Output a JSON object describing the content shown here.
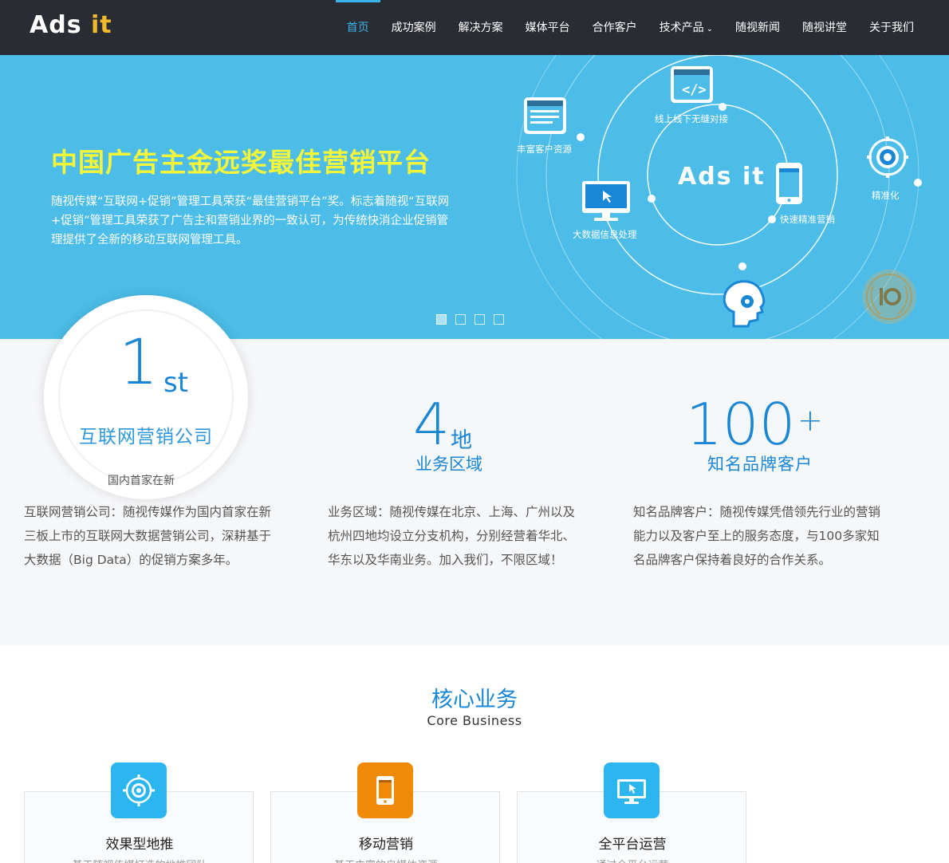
{
  "brand": {
    "logo_main": "Ads ",
    "logo_accent": "it"
  },
  "nav": {
    "items": [
      {
        "label": "首页",
        "active": true
      },
      {
        "label": "成功案例"
      },
      {
        "label": "解决方案"
      },
      {
        "label": "媒体平台"
      },
      {
        "label": "合作客户"
      },
      {
        "label": "技术产品",
        "dropdown": true
      },
      {
        "label": "随视新闻"
      },
      {
        "label": "随视讲堂"
      },
      {
        "label": "关于我们"
      }
    ]
  },
  "hero": {
    "title": "中国广告主金远奖最佳营销平台",
    "description": "随视传媒“互联网+促销”管理工具荣获“最佳营销平台”奖。标志着随视“互联网+促销”管理工具荣获了广告主和营销业界的一致认可，为传统快消企业促销管理提供了全新的移动互联网管理工具。",
    "art": {
      "center_logo": "Ads it",
      "labels": {
        "rich": "丰富客户资源",
        "online": "线上线下无缝对接",
        "precise": "精准化",
        "bigdata": "大数据信息处理",
        "fast": "快速精准营销"
      }
    },
    "slides": 4,
    "active_slide": 1
  },
  "stats": {
    "circle": {
      "number": "1",
      "suffix": "st",
      "label": "互联网营销公司",
      "sub": "国内首家在新"
    },
    "regions": {
      "number": "4",
      "unit": "地",
      "label": "业务区域"
    },
    "brands": {
      "number": "100",
      "plus": "+",
      "label": "知名品牌客户"
    },
    "texts": [
      "互联网营销公司：随视传媒作为国内首家在新三板上市的互联网大数据营销公司，深耕基于大数据（Big Data）的促销方案多年。",
      "业务区域：随视传媒在北京、上海、广州以及杭州四地均设立分支机构，分别经营着华北、华东以及华南业务。加入我们，不限区域！",
      "知名品牌客户：随视传媒凭借领先行业的营销能力以及客户至上的服务态度，与100多家知名品牌客户保持着良好的合作关系。"
    ]
  },
  "core": {
    "title": "核心业务",
    "subtitle": "Core Business",
    "cards": [
      {
        "title": "效果型地推",
        "desc": "基于随视传媒打造的地推团队",
        "icon": "target-icon"
      },
      {
        "title": "移动营销",
        "desc": "基于丰富的自媒体资源",
        "icon": "mobile-icon"
      },
      {
        "title": "全平台运营",
        "desc": "通过全平台运营",
        "icon": "monitor-icon"
      }
    ]
  },
  "colors": {
    "nav_bg": "#2a2c33",
    "hero_bg": "#4bbde8",
    "accent": "#1a86d6",
    "title_yellow": "#f5f53a",
    "orange": "#f18a06"
  }
}
